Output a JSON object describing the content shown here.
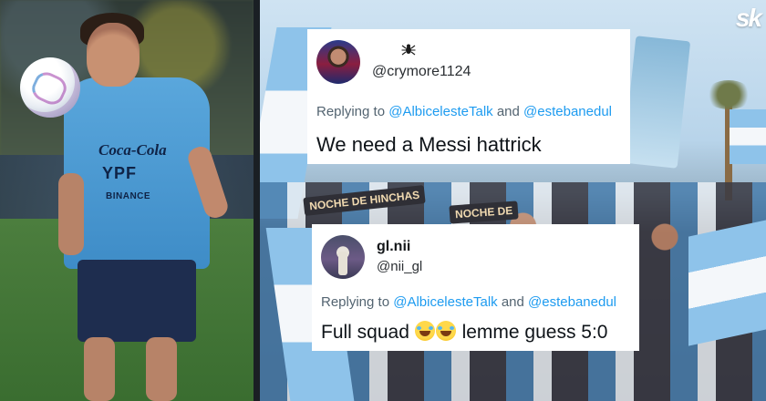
{
  "brand_logo": "sk",
  "left_photo": {
    "shirt_sponsors": [
      "Coca-Cola",
      "YPF",
      "BINANCE"
    ]
  },
  "right_photo": {
    "signs": [
      "NOCHE DE HINCHAS",
      "NOCHE DE"
    ]
  },
  "tweets": [
    {
      "display_name": "",
      "handle": "@crymore1124",
      "emblem_icon": "spider-icon",
      "reply_prefix": "Replying to",
      "reply_user_1": "@AlbicelesteTalk",
      "reply_and": "and",
      "reply_user_2": "@estebanedul",
      "text": "We need a Messi hattrick"
    },
    {
      "display_name": "gl.nii",
      "handle": "@nii_gl",
      "reply_prefix": "Replying to",
      "reply_user_1": "@AlbicelesteTalk",
      "reply_and": "and",
      "reply_user_2": "@estebanedul",
      "text_before": "Full squad",
      "emoji": "😂😂",
      "text_after": "lemme guess 5:0"
    }
  ],
  "colors": {
    "mention": "#1d9bf0",
    "muted_text": "#536471",
    "card_bg": "#ffffff"
  }
}
